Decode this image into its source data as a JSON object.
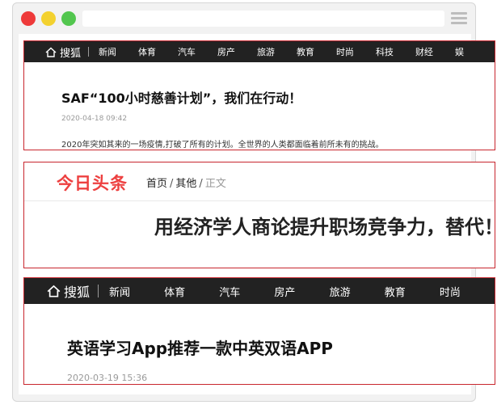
{
  "sohu_article_1": {
    "logo_text": "搜狐",
    "nav": [
      "新闻",
      "体育",
      "汽车",
      "房产",
      "旅游",
      "教育",
      "时尚",
      "科技",
      "财经",
      "娱"
    ],
    "title": "SAF“100小时慈善计划”，我们在行动！",
    "date": "2020-04-18 09:42",
    "snippet": "2020年突如其来的一场疫情,打破了所有的计划。全世界的人类都面临着前所未有的挑战。"
  },
  "toutiao_article": {
    "logo_text": "今日头条",
    "breadcrumb": {
      "home": "首页",
      "other": "其他",
      "current": "正文",
      "separator": "/"
    },
    "title": "用经济学人商论提升职场竞争力，替代！"
  },
  "sohu_article_2": {
    "logo_text": "搜狐",
    "nav": [
      "新闻",
      "体育",
      "汽车",
      "房产",
      "旅游",
      "教育",
      "时尚"
    ],
    "title": "英语学习App推荐一款中英双语APP",
    "date": "2020-03-19 15:36"
  },
  "colors": {
    "card_border": "#c8262e",
    "nav_background": "#222222",
    "toutiao_red": "#ed4040",
    "dot_red": "#ee3a3a",
    "dot_yellow": "#f3d12f",
    "dot_green": "#52c64e"
  }
}
